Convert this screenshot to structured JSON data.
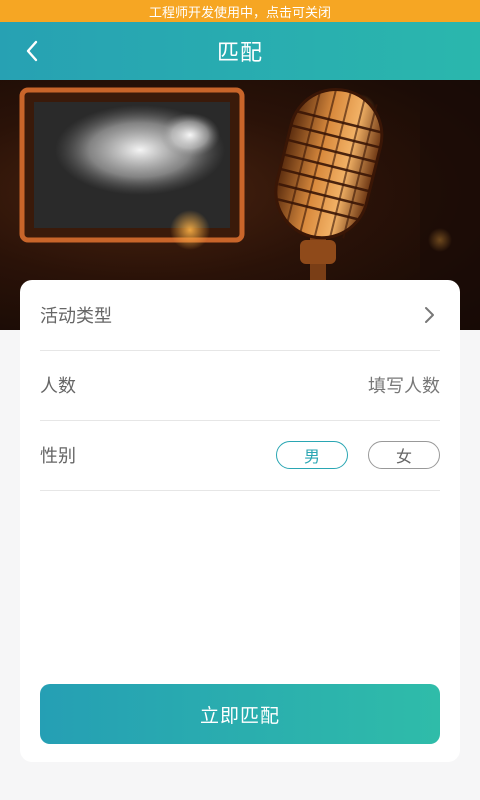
{
  "dev_banner": {
    "text": "工程师开发使用中，点击可关闭"
  },
  "nav": {
    "title": "匹配",
    "back_icon": "chevron-left-icon"
  },
  "hero": {
    "image": "microphone-photo"
  },
  "form": {
    "activity_type": {
      "label": "活动类型",
      "icon": "chevron-right-icon"
    },
    "people_count": {
      "label": "人数",
      "placeholder": "填写人数"
    },
    "gender": {
      "label": "性别",
      "options": [
        "男",
        "女"
      ],
      "selected": "男"
    }
  },
  "submit": {
    "label": "立即匹配"
  },
  "colors": {
    "accent": "#2aa6b3",
    "banner": "#f6a623",
    "nav_gradient_start": "#27a1b3",
    "nav_gradient_end": "#2ab7ad"
  }
}
